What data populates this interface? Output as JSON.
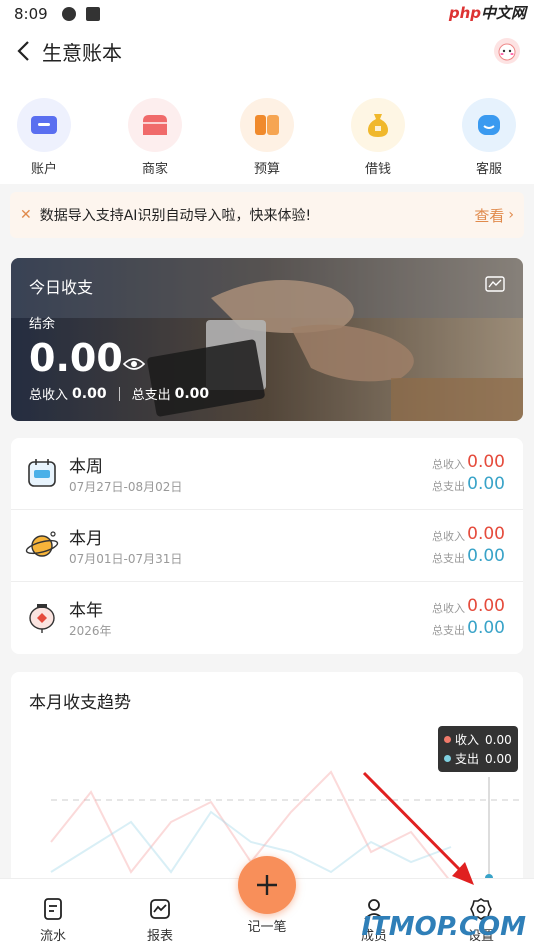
{
  "status_bar": {
    "time": "8:09"
  },
  "watermark_top": {
    "brand_red": "php",
    "brand_dark": "中文网"
  },
  "header": {
    "title": "生意账本"
  },
  "quick_actions": [
    {
      "label": "账户",
      "icon": "wallet-icon",
      "color": "#5a6ff0"
    },
    {
      "label": "商家",
      "icon": "shop-icon",
      "color": "#f06a6a"
    },
    {
      "label": "预算",
      "icon": "budget-icon",
      "color": "#f08a2c"
    },
    {
      "label": "借钱",
      "icon": "money-bag-icon",
      "color": "#f0b82c"
    },
    {
      "label": "客服",
      "icon": "service-icon",
      "color": "#3a9af0"
    }
  ],
  "notice": {
    "text": "数据导入支持AI识别自动导入啦，快来体验!",
    "link": "查看"
  },
  "today": {
    "title": "今日收支",
    "balance_label": "结余",
    "balance": "0.00",
    "income_label": "总收入",
    "income": "0.00",
    "expense_label": "总支出",
    "expense": "0.00"
  },
  "periods": [
    {
      "name": "本周",
      "date": "07月27日-08月02日",
      "income_label": "总收入",
      "income": "0.00",
      "expense_label": "总支出",
      "expense": "0.00"
    },
    {
      "name": "本月",
      "date": "07月01日-07月31日",
      "income_label": "总收入",
      "income": "0.00",
      "expense_label": "总支出",
      "expense": "0.00"
    },
    {
      "name": "本年",
      "date": "2026年",
      "income_label": "总收入",
      "income": "0.00",
      "expense_label": "总支出",
      "expense": "0.00"
    }
  ],
  "trend": {
    "title": "本月收支趋势",
    "tooltip": {
      "income_label": "收入",
      "income": "0.00",
      "expense_label": "支出",
      "expense": "0.00"
    }
  },
  "tabbar": {
    "items": [
      {
        "label": "流水"
      },
      {
        "label": "报表"
      },
      {
        "label": "记一笔"
      },
      {
        "label": "成员"
      },
      {
        "label": "设置"
      }
    ]
  },
  "watermark_bottom": "ITMOP.COM",
  "colors": {
    "accent": "#f88f5a",
    "income": "#e54b3c",
    "expense": "#39a3c8",
    "annotation_arrow": "#e02020"
  }
}
